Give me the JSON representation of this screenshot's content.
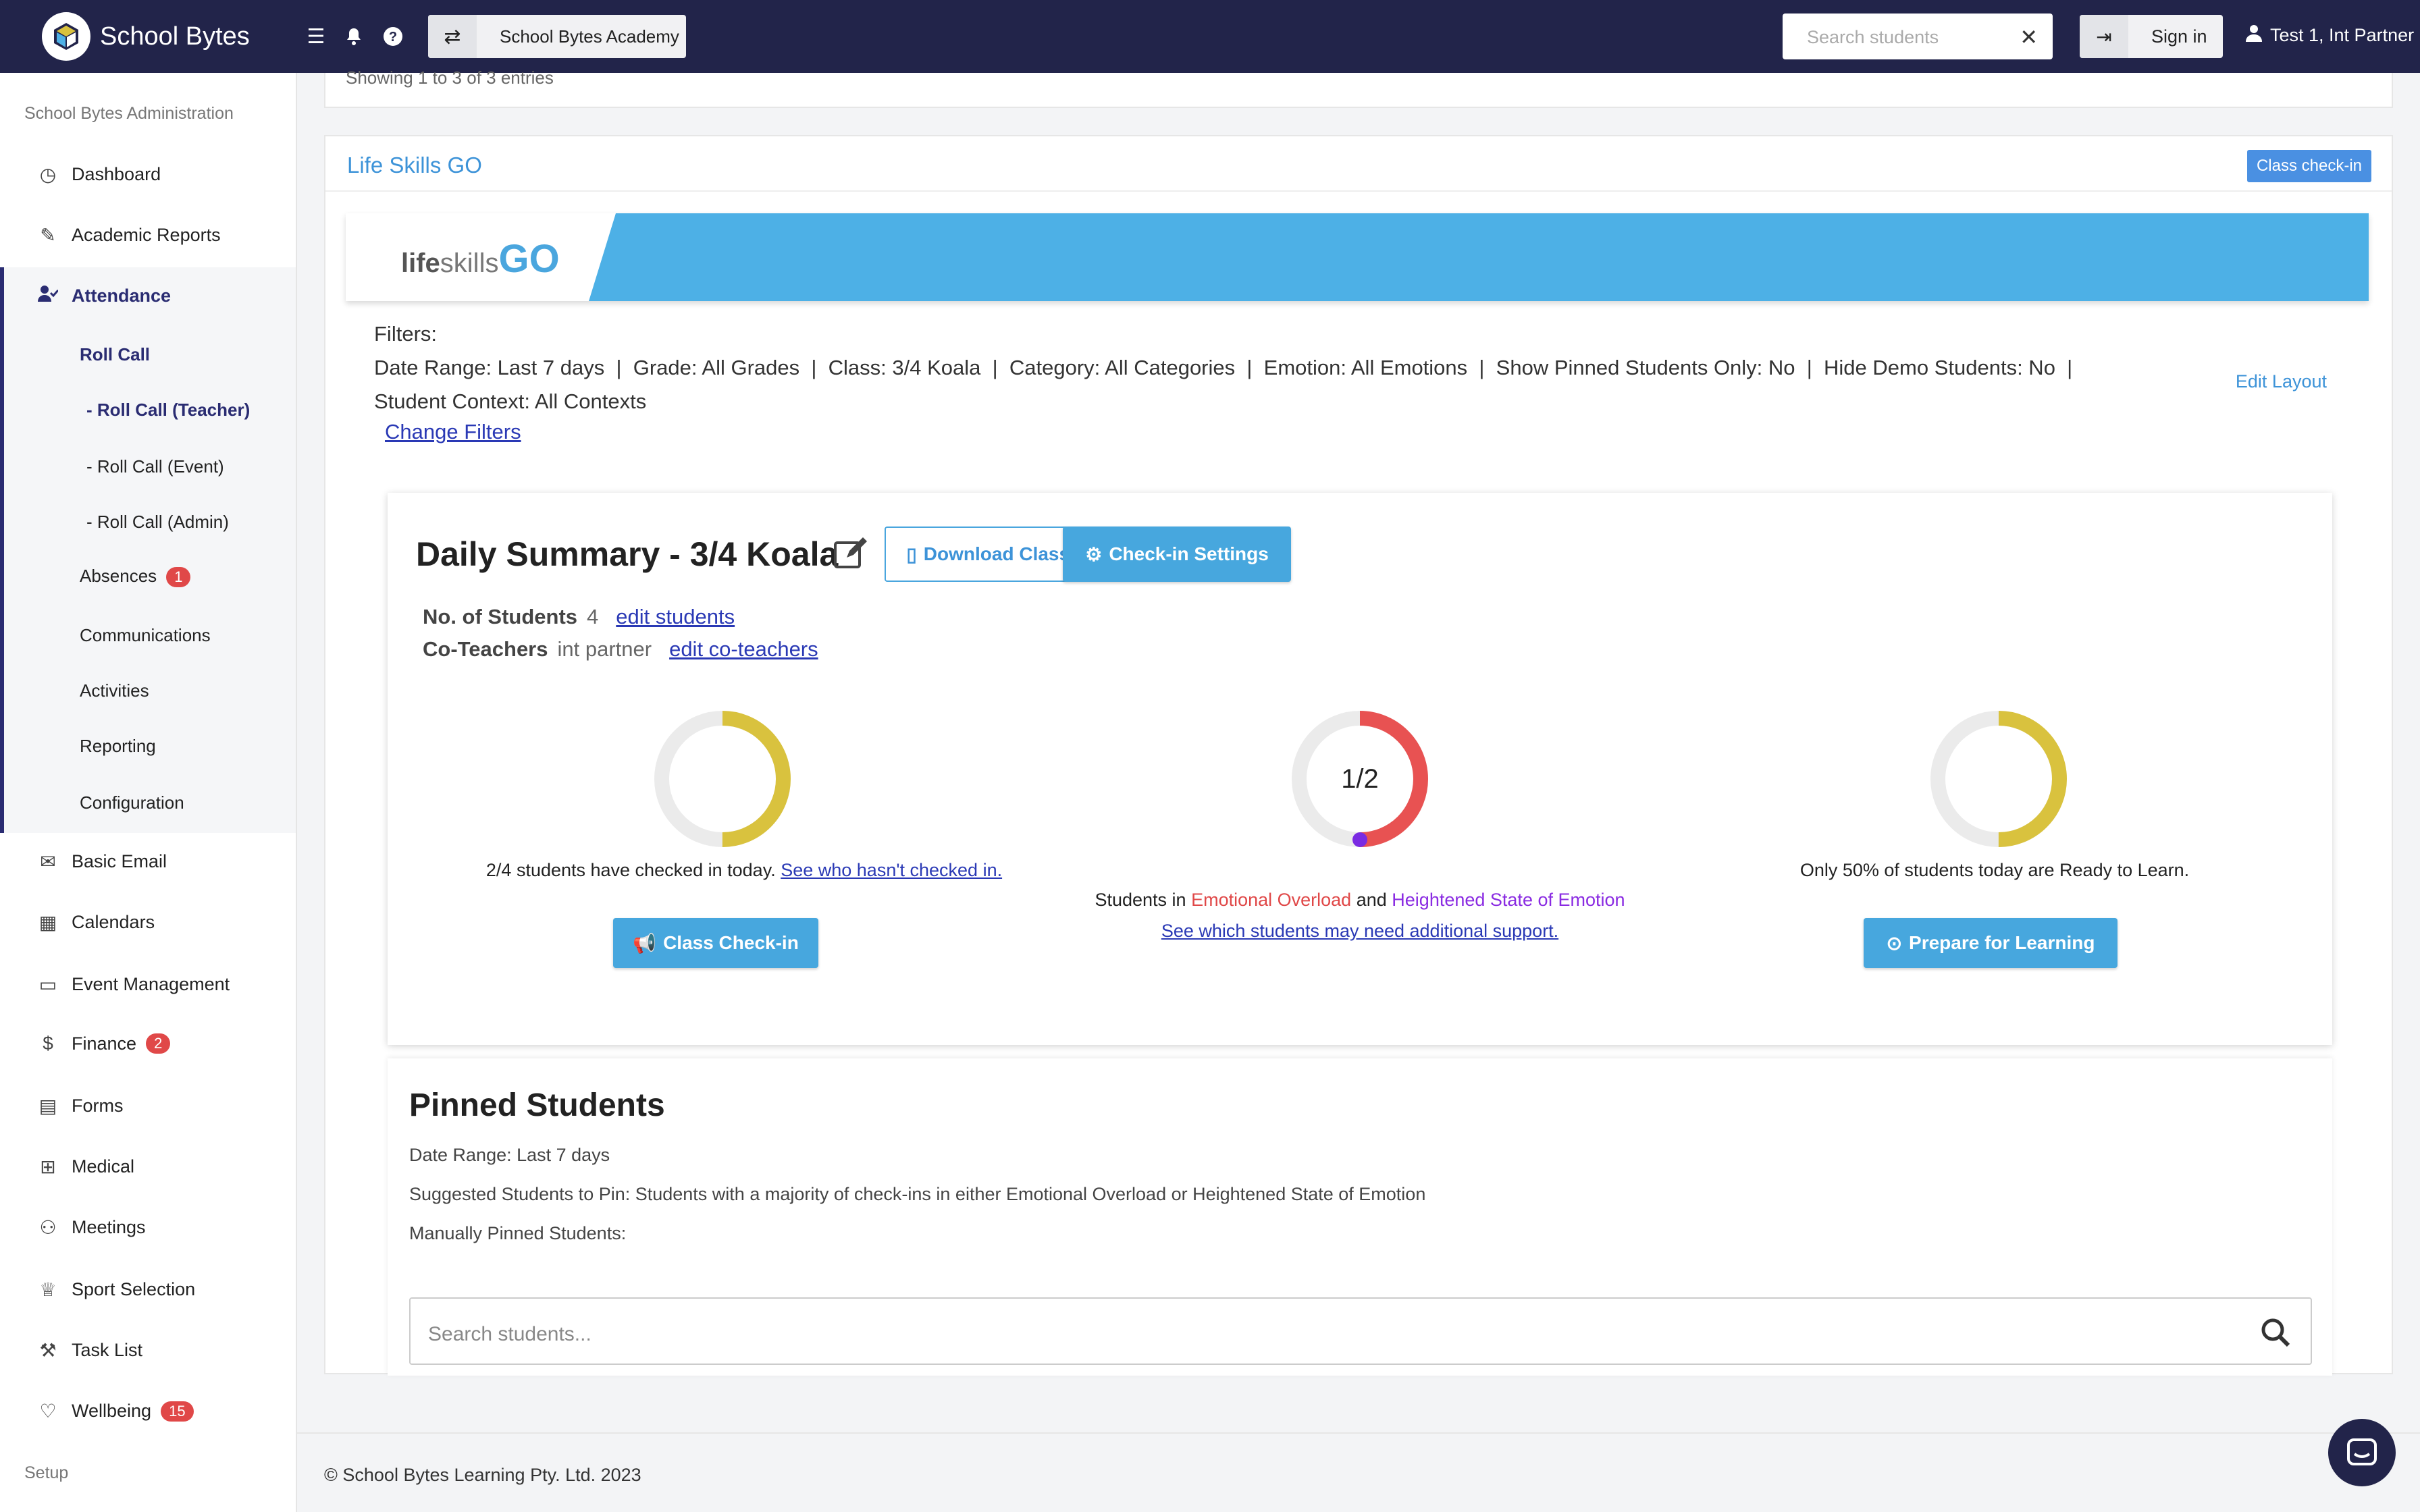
{
  "header": {
    "brand": "School Bytes",
    "academy": "School Bytes Academy",
    "search_placeholder": "Search students",
    "search_clear": "✕",
    "sign_in": "Sign in",
    "user": "Test 1, Int Partner"
  },
  "sidebar": {
    "section_admin": "School Bytes Administration",
    "dashboard": "Dashboard",
    "academic_reports": "Academic Reports",
    "attendance": "Attendance",
    "roll_call": "Roll Call",
    "roll_call_teacher": "- Roll Call (Teacher)",
    "roll_call_event": "- Roll Call (Event)",
    "roll_call_admin": "- Roll Call (Admin)",
    "absences": "Absences",
    "absences_badge": "1",
    "communications": "Communications",
    "activities": "Activities",
    "reporting": "Reporting",
    "configuration": "Configuration",
    "basic_email": "Basic Email",
    "calendars": "Calendars",
    "event_management": "Event Management",
    "finance": "Finance",
    "finance_badge": "2",
    "forms": "Forms",
    "medical": "Medical",
    "meetings": "Meetings",
    "sport_selection": "Sport Selection",
    "task_list": "Task List",
    "wellbeing": "Wellbeing",
    "wellbeing_badge": "15",
    "section_setup": "Setup"
  },
  "main": {
    "cut_text": "Showing 1 to 3 of 3 entries",
    "panel_title": "Life Skills GO",
    "class_checkin_tag": "Class check-in",
    "logo_life": "life",
    "logo_skills": "skills",
    "logo_go": "GO",
    "filters_label": "Filters:",
    "filters_line1": "Date Range: Last 7 days  |  Grade: All Grades  |  Class: 3/4 Koala  |  Category: All Categories  |  Emotion: All Emotions  |  Show Pinned Students Only: No  |  Hide Demo Students: No  |",
    "filters_line2": "Student Context: All Contexts",
    "change_filters": "Change Filters",
    "edit_layout": "Edit Layout"
  },
  "summary": {
    "title": "Daily Summary - 3/4 Koala",
    "download_btn": "Download Class Logins",
    "settings_btn": "Check-in Settings",
    "students_label": "No. of Students",
    "students_value": "4",
    "edit_students": "edit students",
    "coteachers_label": "Co-Teachers",
    "coteachers_value": "int partner",
    "edit_coteachers": "edit co-teachers",
    "donut1": {
      "fraction": 0.5,
      "color": "#d9c23e"
    },
    "donut2": {
      "label": "1/2",
      "fraction": 0.5,
      "color": "#e85252",
      "dot_color": "#7a2be2"
    },
    "donut3": {
      "fraction": 0.5,
      "color": "#d9c23e"
    },
    "cap1_text": "2/4 students have checked in today.",
    "cap1_link": "See who hasn't checked in.",
    "cap2_pre": "Students in",
    "cap2_red": "Emotional Overload",
    "cap2_and": "and",
    "cap2_purple": "Heightened State of Emotion",
    "cap2_link": "See which students may need additional support.",
    "cap3_text": "Only 50% of students today are Ready to Learn.",
    "btn_class_checkin": "Class Check-in",
    "btn_prepare": "Prepare for Learning"
  },
  "pinned": {
    "title": "Pinned Students",
    "date_range": "Date Range: Last 7 days",
    "suggested": "Suggested Students to Pin: Students with a majority of check-ins in either Emotional Overload or Heightened State of Emotion",
    "manual": "Manually Pinned Students:",
    "search_placeholder": "Search students..."
  },
  "footer": {
    "copyright": "© School Bytes Learning Pty. Ltd. 2023"
  }
}
